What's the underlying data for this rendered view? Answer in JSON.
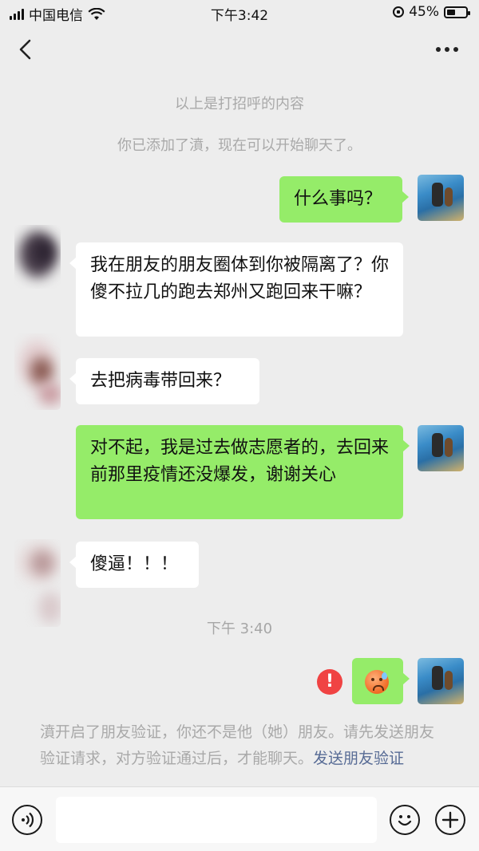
{
  "status_bar": {
    "carrier": "中国电信",
    "time": "下午3:42",
    "battery": "45%",
    "battery_level": 0.45
  },
  "nav": {
    "title": "",
    "back_icon": "chevron-left-icon",
    "more_icon": "more-dots-icon"
  },
  "system": {
    "above_note": "以上是打招呼的内容",
    "added_note": "你已添加了濆，现在可以开始聊天了。"
  },
  "messages": [
    {
      "side": "right",
      "text": "什么事吗？"
    },
    {
      "side": "left",
      "text": "我在朋友的朋友圈体到你被隔离了？你傻不拉几的跑去郑州又跑回来干嘛？"
    },
    {
      "side": "left",
      "text": "去把病毒带回来？"
    },
    {
      "side": "right",
      "text": "对不起，我是过去做志愿者的，去回来前那里疫情还没爆发，谢谢关心"
    },
    {
      "side": "left",
      "text": "傻逼！！！"
    }
  ],
  "time_divider": "下午 3:40",
  "failed_message": {
    "icon": "anxious-sweat-emoji",
    "error_mark": "!"
  },
  "verify_note": {
    "text": "濆开启了朋友验证，你还不是他（她）朋友。请先发送朋友验证请求，对方验证通过后，才能聊天。",
    "link": "发送朋友验证"
  },
  "input_bar": {
    "value": "",
    "voice_icon": "voice-icon",
    "emoji_icon": "emoji-icon",
    "plus_icon": "plus-icon"
  },
  "colors": {
    "background": "#ededed",
    "bubble_self": "#95ec69",
    "bubble_other": "#ffffff",
    "link": "#576b95",
    "error": "#f04343"
  }
}
